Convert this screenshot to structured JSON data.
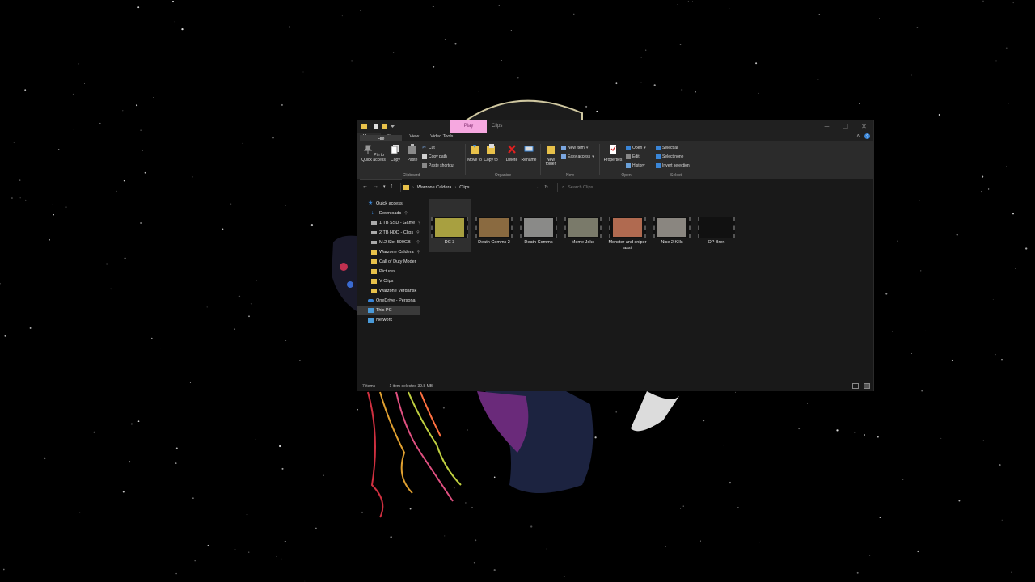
{
  "window": {
    "context_tab": "Play",
    "title": "Clips"
  },
  "ribbon": {
    "tabs": [
      "File",
      "Home",
      "Share",
      "View",
      "Video Tools"
    ],
    "clipboard": {
      "pin_label": "Pin to Quick access",
      "copy_label": "Copy",
      "paste_label": "Paste",
      "cut_label": "Cut",
      "copy_path_label": "Copy path",
      "paste_shortcut_label": "Paste shortcut",
      "group_label": "Clipboard"
    },
    "organise": {
      "move_to_label": "Move to",
      "copy_to_label": "Copy to",
      "delete_label": "Delete",
      "rename_label": "Rename",
      "group_label": "Organise"
    },
    "new": {
      "new_folder_label": "New folder",
      "new_item_label": "New item",
      "easy_access_label": "Easy access",
      "group_label": "New"
    },
    "open": {
      "properties_label": "Properties",
      "open_label": "Open",
      "edit_label": "Edit",
      "history_label": "History",
      "group_label": "Open"
    },
    "select": {
      "select_all_label": "Select all",
      "select_none_label": "Select none",
      "invert_label": "Invert selection",
      "group_label": "Select"
    }
  },
  "address": {
    "crumbs": [
      "Warzone Caldera",
      "Clips"
    ],
    "search_placeholder": "Search Clips"
  },
  "nav_pane": {
    "quick_access": "Quick access",
    "items": [
      {
        "label": "Downloads",
        "pinned": true
      },
      {
        "label": "1 TB SSD - Game",
        "pinned": true
      },
      {
        "label": "2 TB HDD - Clips",
        "pinned": true
      },
      {
        "label": "M.2 Slot 500GB -",
        "pinned": true
      },
      {
        "label": "Warzone Caldera",
        "pinned": true
      },
      {
        "label": "Call of Duty  Moder",
        "pinned": false
      },
      {
        "label": "Pictures",
        "pinned": false
      },
      {
        "label": "V Clips",
        "pinned": false
      },
      {
        "label": "Warzone Verdansk",
        "pinned": false
      }
    ],
    "onedrive": "OneDrive - Personal",
    "this_pc": "This PC",
    "network": "Network"
  },
  "files": [
    {
      "name": "DC 3",
      "color": "#9a5a6a"
    },
    {
      "name": "Death Comms 2",
      "color": "#a8a040"
    },
    {
      "name": "Death Comms",
      "color": "#8a6a40"
    },
    {
      "name": "Meme Joke",
      "color": "#8a8a88"
    },
    {
      "name": "Monster and sniper assi",
      "color": "#7a7a6a"
    },
    {
      "name": "Nice 2 Kills",
      "color": "#b06a50"
    },
    {
      "name": "OP Bren",
      "color": "#8a8680"
    }
  ],
  "status": {
    "item_count": "7 items",
    "selection": "1 item selected  39.8 MB"
  },
  "colors": {
    "window_bg": "#191919",
    "ribbon_bg": "#2b2b2b",
    "context_tab": "#f6a8e0",
    "folder": "#e8c14a",
    "accent_blue": "#3a86d8"
  }
}
